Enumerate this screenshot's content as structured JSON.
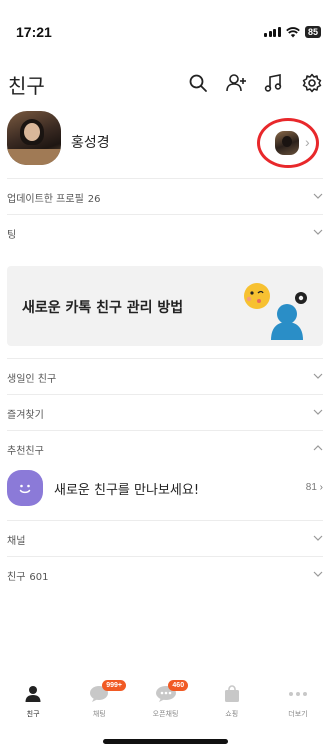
{
  "status_bar": {
    "time": "17:21",
    "battery": "85"
  },
  "header": {
    "title": "친구",
    "icons": [
      "search-icon",
      "add-friend-icon",
      "music-icon",
      "settings-icon"
    ]
  },
  "profile": {
    "name": "홍성경"
  },
  "sections_top": [
    {
      "label": "업데이트한 프로필",
      "count": "26"
    },
    {
      "label": "팅",
      "count": ""
    }
  ],
  "banner": {
    "text": "새로운 카톡 친구 관리 방법"
  },
  "sections_mid": [
    {
      "label": "생일인 친구",
      "count": ""
    },
    {
      "label": "즐겨찾기",
      "count": ""
    },
    {
      "label": "추천친구",
      "count": ""
    }
  ],
  "recommended": {
    "text": "새로운 친구를 만나보세요!",
    "count": "81"
  },
  "sections_bottom": [
    {
      "label": "채널",
      "count": ""
    },
    {
      "label": "친구",
      "count": "601"
    }
  ],
  "tabs": [
    {
      "label": "친구",
      "icon": "person-icon",
      "badge": ""
    },
    {
      "label": "채팅",
      "icon": "chat-icon",
      "badge": "999+"
    },
    {
      "label": "오픈채팅",
      "icon": "open-chat-icon",
      "badge": "460"
    },
    {
      "label": "쇼핑",
      "icon": "shopping-bag-icon",
      "badge": ""
    },
    {
      "label": "더보기",
      "icon": "more-icon",
      "badge": ""
    }
  ],
  "colors": {
    "accent_red": "#e8282b",
    "badge_orange": "#f15a24",
    "rec_purple": "#8b7ad8",
    "banner_bg": "#f2f2f2"
  }
}
